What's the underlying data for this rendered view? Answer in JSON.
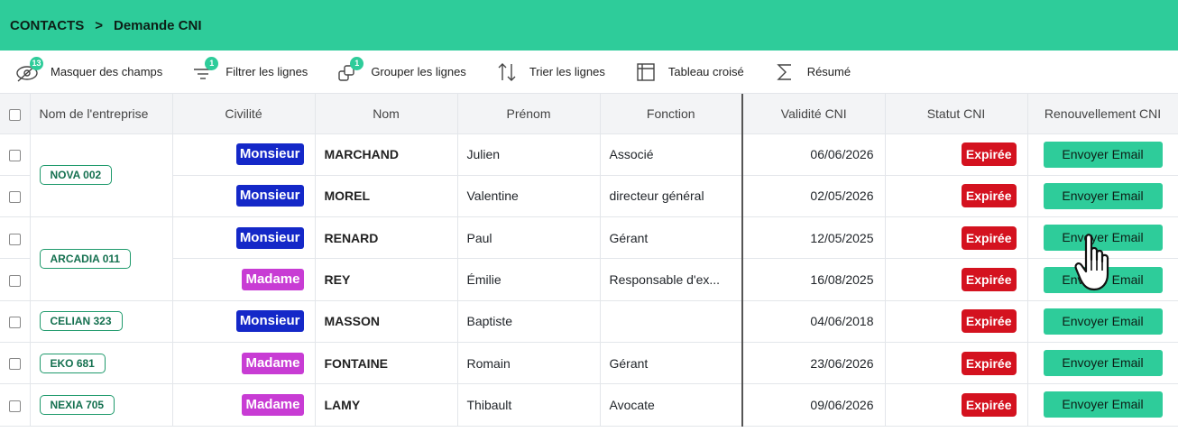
{
  "breadcrumb": {
    "root": "CONTACTS",
    "separator": ">",
    "current": "Demande CNI"
  },
  "toolbar": {
    "hide_fields": {
      "label": "Masquer des champs",
      "badge": "13",
      "icon": "eye-off-icon"
    },
    "filter": {
      "label": "Filtrer les lignes",
      "badge": "1",
      "icon": "filter-icon"
    },
    "group": {
      "label": "Grouper les lignes",
      "badge": "1",
      "icon": "group-icon"
    },
    "sort": {
      "label": "Trier les lignes",
      "icon": "sort-icon"
    },
    "pivot": {
      "label": "Tableau croisé",
      "icon": "pivot-icon"
    },
    "summary": {
      "label": "Résumé",
      "icon": "sigma-icon"
    }
  },
  "columns": [
    "Nom de l'entreprise",
    "Civilité",
    "Nom",
    "Prénom",
    "Fonction",
    "Validité CNI",
    "Statut CNI",
    "Renouvellement CNI"
  ],
  "groups": [
    {
      "company": "NOVA 002",
      "rows": [
        {
          "civilite": "Monsieur",
          "nom": "MARCHAND",
          "prenom": "Julien",
          "fonction": "Associé",
          "validite": "06/06/2026",
          "statut": "Expirée",
          "action": "Envoyer Email"
        },
        {
          "civilite": "Monsieur",
          "nom": "MOREL",
          "prenom": "Valentine",
          "fonction": "directeur général",
          "validite": "02/05/2026",
          "statut": "Expirée",
          "action": "Envoyer Email"
        }
      ]
    },
    {
      "company": "ARCADIA 011",
      "rows": [
        {
          "civilite": "Monsieur",
          "nom": "RENARD",
          "prenom": "Paul",
          "fonction": "Gérant",
          "validite": "12/05/2025",
          "statut": "Expirée",
          "action": "Envoyer Email"
        },
        {
          "civilite": "Madame",
          "nom": "REY",
          "prenom": "Émilie",
          "fonction": "Responsable d'ex...",
          "validite": "16/08/2025",
          "statut": "Expirée",
          "action": "Envoyer Email"
        }
      ]
    },
    {
      "company": "CELIAN 323",
      "rows": [
        {
          "civilite": "Monsieur",
          "nom": "MASSON",
          "prenom": "Baptiste",
          "fonction": "",
          "validite": "04/06/2018",
          "statut": "Expirée",
          "action": "Envoyer Email"
        }
      ]
    },
    {
      "company": "EKO 681",
      "rows": [
        {
          "civilite": "Madame",
          "nom": "FONTAINE",
          "prenom": "Romain",
          "fonction": "Gérant",
          "validite": "23/06/2026",
          "statut": "Expirée",
          "action": "Envoyer Email"
        }
      ]
    },
    {
      "company": "NEXIA 705",
      "rows": [
        {
          "civilite": "Madame",
          "nom": "LAMY",
          "prenom": "Thibault",
          "fonction": "Avocate",
          "validite": "09/06/2026",
          "statut": "Expirée",
          "action": "Envoyer Email"
        }
      ]
    }
  ],
  "colors": {
    "accent": "#2ecc9a",
    "monsieur": "#1428c8",
    "madame": "#c83cd4",
    "expired": "#d4121f"
  }
}
